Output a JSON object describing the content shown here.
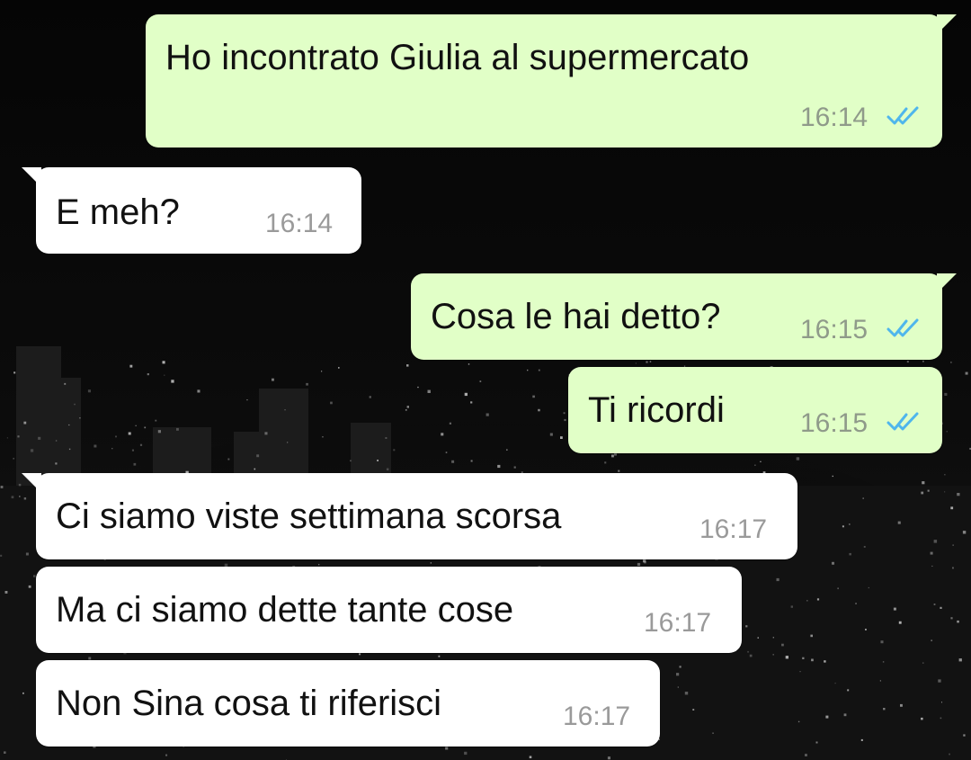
{
  "messages": [
    {
      "dir": "out",
      "text": "Ho incontrato Giulia al supermercato",
      "time": "16:14",
      "status": "read"
    },
    {
      "dir": "in",
      "text": "E meh?",
      "time": "16:14"
    },
    {
      "dir": "out",
      "text": "Cosa le hai detto?",
      "time": "16:15",
      "status": "read"
    },
    {
      "dir": "out",
      "text": "Ti ricordi",
      "time": "16:15",
      "status": "read"
    },
    {
      "dir": "in",
      "text": "Ci siamo viste settimana scorsa",
      "time": "16:17"
    },
    {
      "dir": "in",
      "text": "Ma ci siamo dette tante cose",
      "time": "16:17"
    },
    {
      "dir": "in",
      "text": "Non Sina cosa ti riferisci",
      "time": "16:17"
    }
  ],
  "colors": {
    "outgoing_bubble": "#e1ffc7",
    "incoming_bubble": "#ffffff",
    "read_ticks": "#4fb6ec",
    "wallpaper": "#0a0a0a"
  },
  "icons": {
    "read_status": "double-check-icon"
  }
}
